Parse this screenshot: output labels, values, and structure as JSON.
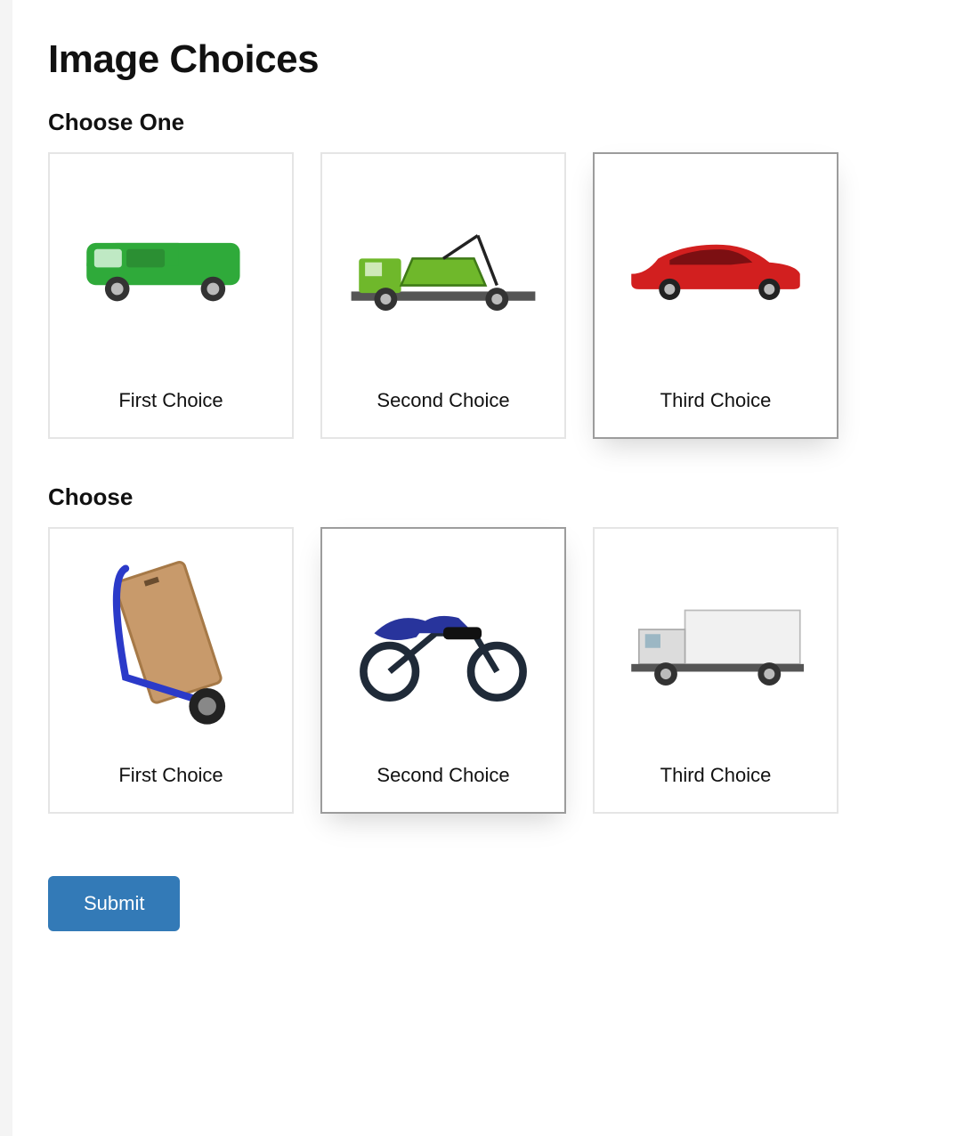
{
  "title": "Image Choices",
  "groups": [
    {
      "heading": "Choose One",
      "items": [
        {
          "label": "First Choice",
          "icon": "van-icon",
          "selected": false
        },
        {
          "label": "Second Choice",
          "icon": "skip-truck-icon",
          "selected": false
        },
        {
          "label": "Third Choice",
          "icon": "sedan-icon",
          "selected": true
        }
      ]
    },
    {
      "heading": "Choose",
      "items": [
        {
          "label": "First Choice",
          "icon": "hand-truck-icon",
          "selected": false
        },
        {
          "label": "Second Choice",
          "icon": "motorcycle-icon",
          "selected": true
        },
        {
          "label": "Third Choice",
          "icon": "box-truck-icon",
          "selected": false
        }
      ]
    }
  ],
  "submit_label": "Submit",
  "colors": {
    "primary_button": "#337ab7",
    "selected_border": "#9c9c9c",
    "default_border": "#e5e5e5"
  }
}
